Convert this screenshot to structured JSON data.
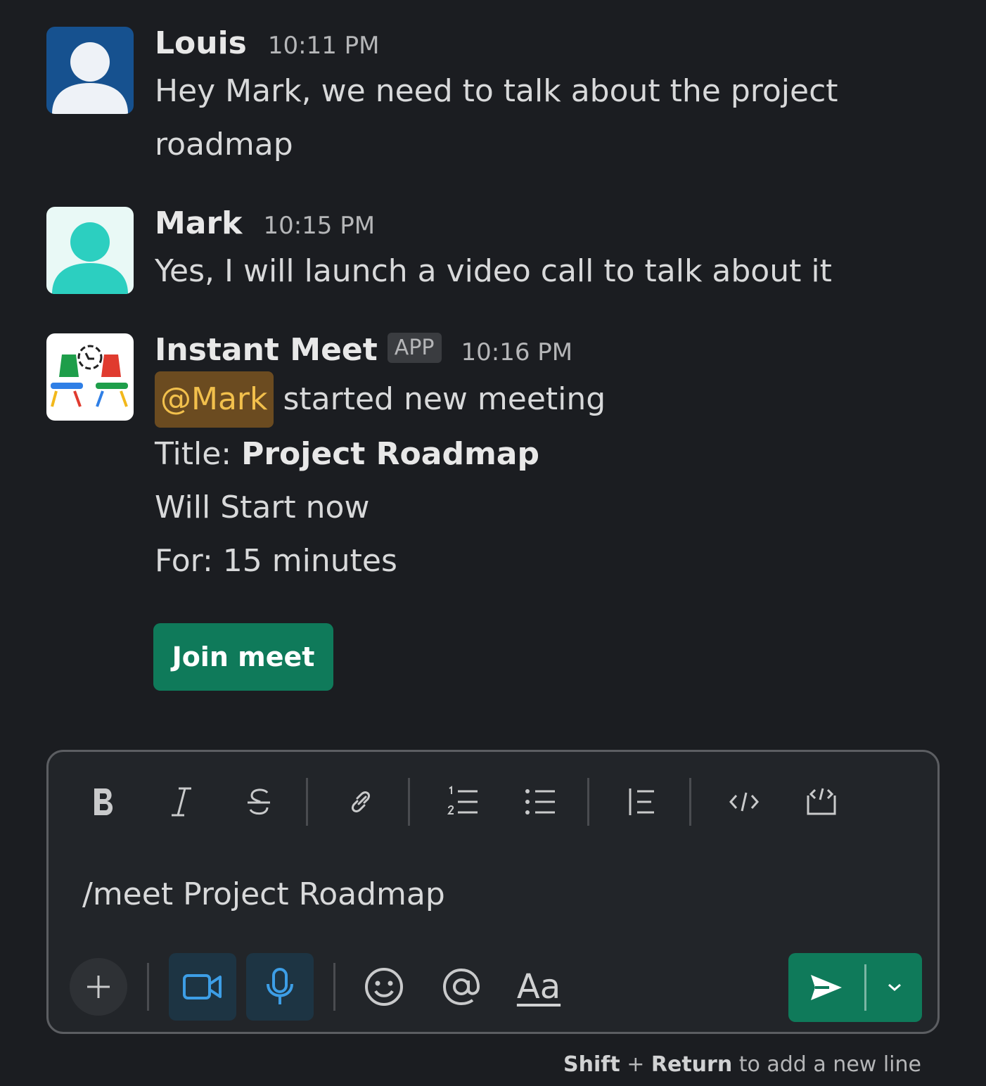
{
  "messages": [
    {
      "author": "Louis",
      "time": "10:11 PM",
      "avatar_icon": "user-avatar-blue",
      "text": "Hey Mark, we need to talk about the project roadmap"
    },
    {
      "author": "Mark",
      "time": "10:15 PM",
      "avatar_icon": "user-avatar-teal",
      "text": "Yes, I will launch a video call to talk about it"
    },
    {
      "author": "Instant Meet",
      "badge": "APP",
      "time": "10:16 PM",
      "avatar_icon": "instant-meet-logo",
      "mention": "@Mark",
      "action_text": " started new meeting",
      "title_label": "Title: ",
      "title_value": "Project Roadmap",
      "start_text": "Will Start now",
      "duration_text": "For: 15 minutes",
      "button_label": "Join meet"
    }
  ],
  "composer": {
    "toolbar": [
      "bold-icon",
      "italic-icon",
      "strikethrough-icon",
      "link-icon",
      "ordered-list-icon",
      "bulleted-list-icon",
      "blockquote-icon",
      "code-icon",
      "code-block-icon"
    ],
    "input_value": "/meet Project Roadmap",
    "format_label": "Aa",
    "accent_color": "#0f7a5a"
  },
  "hint": {
    "key1": "Shift",
    "plus": " + ",
    "key2": "Return",
    "rest": " to add a new line"
  }
}
